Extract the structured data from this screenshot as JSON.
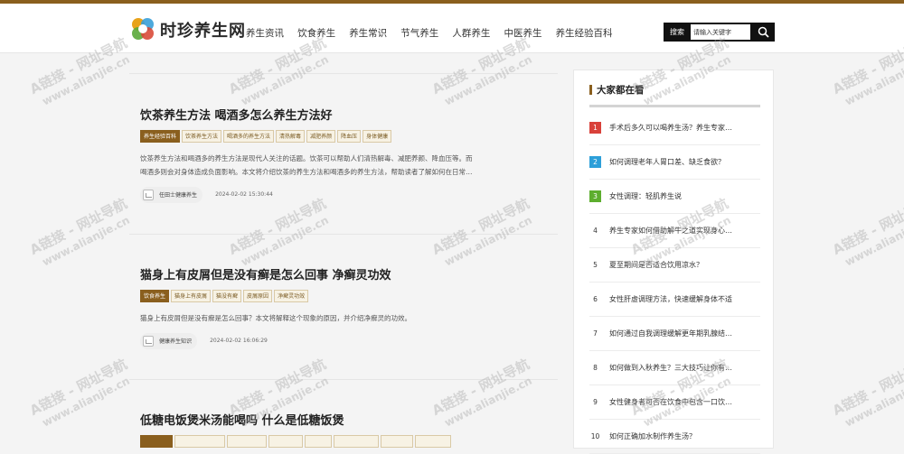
{
  "site": {
    "logo_text": "时珍养生网",
    "brand_color": "#8a5f1e"
  },
  "nav": {
    "items": [
      "养生资讯",
      "饮食养生",
      "养生常识",
      "节气养生",
      "人群养生",
      "中医养生",
      "养生经验百科"
    ]
  },
  "search": {
    "label": "搜索",
    "placeholder": "请输入关键字",
    "button_icon": "search-icon"
  },
  "articles": [
    {
      "title": "饮茶养生方法 喝酒多怎么养生方法好",
      "tags": [
        "养生经验百科",
        "饮茶养生方法",
        "喝酒多的养生方法",
        "清热解毒",
        "减肥养颜",
        "降血压",
        "身体健康"
      ],
      "excerpt": [
        "饮茶养生方法和喝酒多的养生方法是现代人关注的话题。饮茶可以帮助人们清热解毒、减肥养颜、降血压等。而",
        "喝酒多则会对身体造成负面影响。本文将介绍饮茶的养生方法和喝酒多的养生方法，帮助读者了解如何在日常…"
      ],
      "author": "任田士健康养生",
      "date": "2024-02-02 15:30:44"
    },
    {
      "title": "猫身上有皮屑但是没有癣是怎么回事 净癣灵功效",
      "tags": [
        "饮食养生",
        "猫身上有皮屑",
        "猫没有癣",
        "皮屑原因",
        "净癣灵功效"
      ],
      "excerpt": [
        "猫身上有皮屑但是没有癣是怎么回事？本文将解释这个现象的原因，并介绍净癣灵的功效。"
      ],
      "author": "健康养生知识",
      "date": "2024-02-02 16:06:29"
    },
    {
      "title": "低糖电饭煲米汤能喝吗 什么是低糖饭煲",
      "tags": [
        "",
        "",
        "",
        "",
        "",
        "",
        "",
        ""
      ],
      "excerpt": [],
      "author": "",
      "date": ""
    }
  ],
  "sidebar": {
    "title": "大家都在看",
    "items": [
      {
        "rank": "1",
        "text": "手术后多久可以喝养生汤？养生专家…"
      },
      {
        "rank": "2",
        "text": "如何调理老年人胃口差、缺乏食欲？"
      },
      {
        "rank": "3",
        "text": "女性调理：轻肌养生说"
      },
      {
        "rank": "4",
        "text": "养生专家如何借助解牛之道实现身心…"
      },
      {
        "rank": "5",
        "text": "夏至期间是否适合饮用凉水？"
      },
      {
        "rank": "6",
        "text": "女性肝虚调理方法，快速缓解身体不适"
      },
      {
        "rank": "7",
        "text": "如何通过自我调理缓解更年期乳腺结…"
      },
      {
        "rank": "8",
        "text": "如何做到入秋养生？三大技巧让你有…"
      },
      {
        "rank": "9",
        "text": "女性健身者可否在饮食中包含一口饮…"
      },
      {
        "rank": "10",
        "text": "如何正确加水制作养生汤？"
      }
    ],
    "rank_colors": [
      "#d9413a",
      "#2d9fd9",
      "#5dae2e"
    ]
  },
  "watermark": {
    "line1": "A链接 - 网址导航",
    "line2": "www.alianjie.cn"
  }
}
